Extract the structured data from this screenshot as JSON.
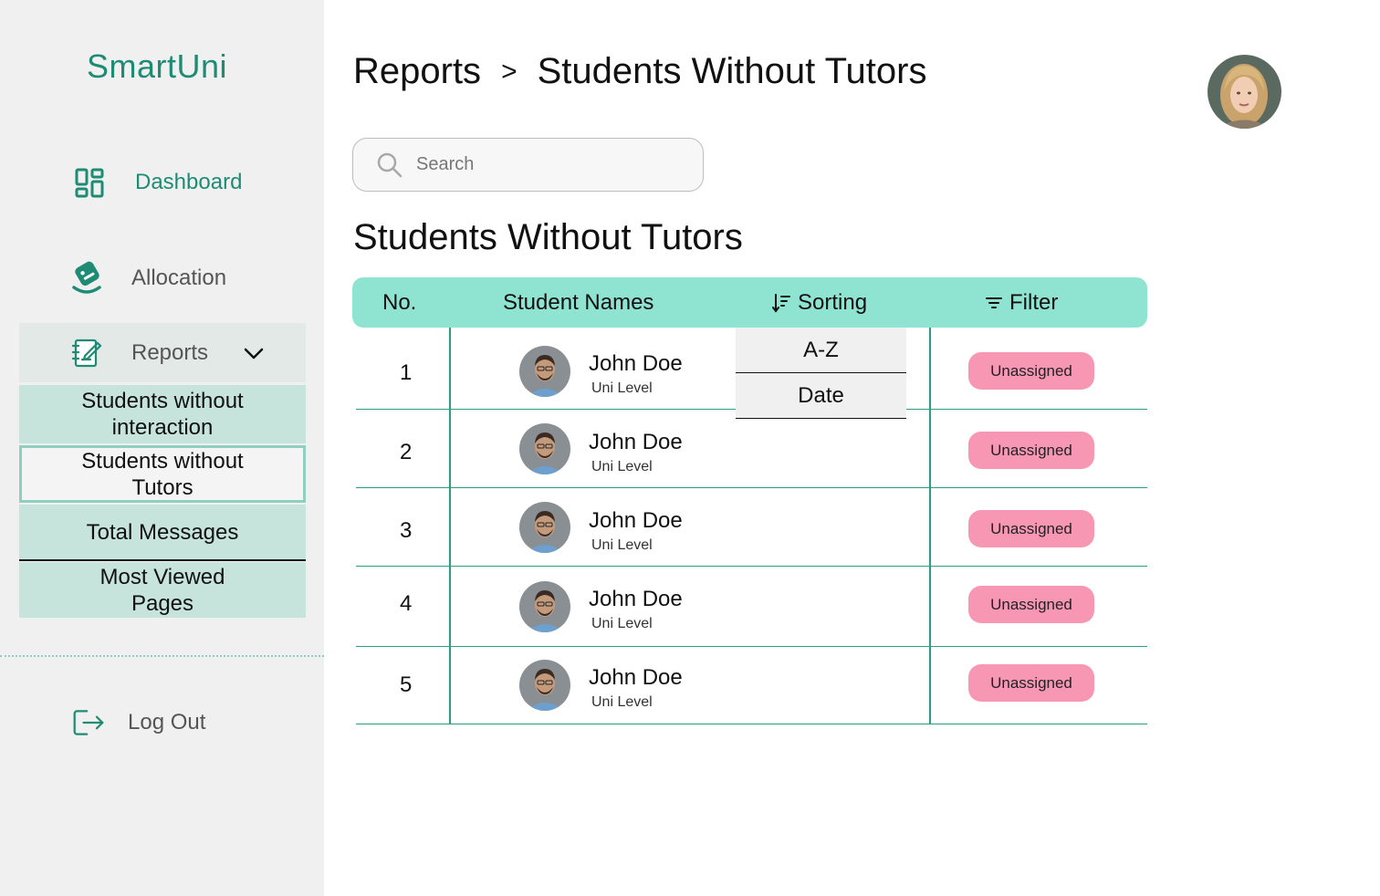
{
  "app": {
    "name": "SmartUni"
  },
  "sidebar": {
    "items": [
      {
        "label": "Dashboard",
        "icon": "dashboard-icon"
      },
      {
        "label": "Allocation",
        "icon": "allocation-icon"
      },
      {
        "label": "Reports",
        "icon": "reports-icon"
      }
    ],
    "reports_submenu": [
      {
        "label": "Students without interaction"
      },
      {
        "label": "Students without Tutors",
        "active": true
      },
      {
        "label": "Total Messages"
      },
      {
        "label": "Most Viewed Pages"
      }
    ],
    "logout_label": "Log Out"
  },
  "header": {
    "breadcrumb": [
      "Reports",
      "Students Without Tutors"
    ],
    "breadcrumb_separator": ">"
  },
  "search": {
    "placeholder": "Search"
  },
  "section_title": "Students Without Tutors",
  "table": {
    "columns": {
      "no": "No.",
      "name": "Student Names",
      "sorting": "Sorting",
      "filter": "Filter"
    },
    "rows": [
      {
        "no": "1",
        "name": "John Doe",
        "level": "Uni Level",
        "status": "Unassigned"
      },
      {
        "no": "2",
        "name": "John Doe",
        "level": "Uni Level",
        "status": "Unassigned"
      },
      {
        "no": "3",
        "name": "John Doe",
        "level": "Uni Level",
        "status": "Unassigned"
      },
      {
        "no": "4",
        "name": "John Doe",
        "level": "Uni Level",
        "status": "Unassigned"
      },
      {
        "no": "5",
        "name": "John Doe",
        "level": "Uni Level",
        "status": "Unassigned"
      }
    ]
  },
  "sort_dropdown": {
    "options": [
      "A-Z",
      "Date"
    ]
  },
  "colors": {
    "brand": "#1e8c74",
    "header_bg": "#8ee3d1",
    "submenu_bg": "#c6e3dc",
    "badge": "#f797b3",
    "row_line": "#2a9d85"
  }
}
